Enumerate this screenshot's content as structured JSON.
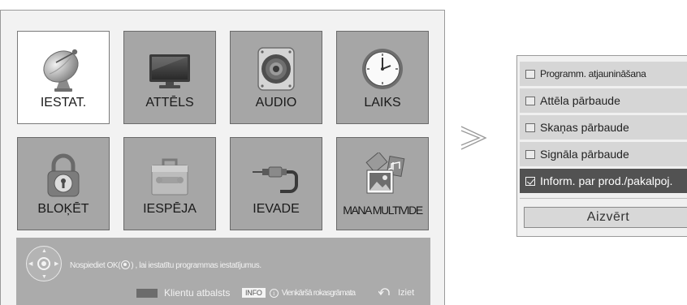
{
  "menu": {
    "tiles": [
      {
        "label": "IESTAT.",
        "icon": "satellite-dish-icon",
        "selected": true
      },
      {
        "label": "ATTĒLS",
        "icon": "tv-screen-icon",
        "selected": false
      },
      {
        "label": "AUDIO",
        "icon": "speaker-icon",
        "selected": false
      },
      {
        "label": "LAIKS",
        "icon": "clock-icon",
        "selected": false
      },
      {
        "label": "BLOĶĒT",
        "icon": "padlock-icon",
        "selected": false
      },
      {
        "label": "IESPĒJA",
        "icon": "toolbox-icon",
        "selected": false
      },
      {
        "label": "IEVADE",
        "icon": "input-cable-icon",
        "selected": false
      },
      {
        "label": "MANA MULTIVIDE",
        "icon": "photo-media-icon",
        "selected": false
      }
    ]
  },
  "footer": {
    "hint_prefix": "Nospiediet OK(",
    "hint_suffix": ") , lai iestatītu programmas iestatījumus.",
    "customer_support": "Klientu atbalsts",
    "info_key": "INFO",
    "info_glyph": "i",
    "simple_manual": "Vienkāršā rokasgrāmata",
    "exit": "Iziet"
  },
  "arrow": ">",
  "settings_list": {
    "items": [
      {
        "label": "Programm. atjaunināšana",
        "checked": false,
        "selected": false
      },
      {
        "label": "Attēla pārbaude",
        "checked": false,
        "selected": false
      },
      {
        "label": "Skaņas pārbaude",
        "checked": false,
        "selected": false
      },
      {
        "label": "Signāla pārbaude",
        "checked": false,
        "selected": false
      },
      {
        "label": "Inform. par prod./pakalpoj.",
        "checked": true,
        "selected": true
      }
    ],
    "close_label": "Aizvērt"
  },
  "colors": {
    "panel_bg": "#f2f2f2",
    "tile_bg": "#a6a6a6",
    "tile_selected_bg": "#ffffff",
    "footer_bg": "#ababab",
    "list_row_bg": "#d6d6d6",
    "list_selected_bg": "#525252"
  }
}
